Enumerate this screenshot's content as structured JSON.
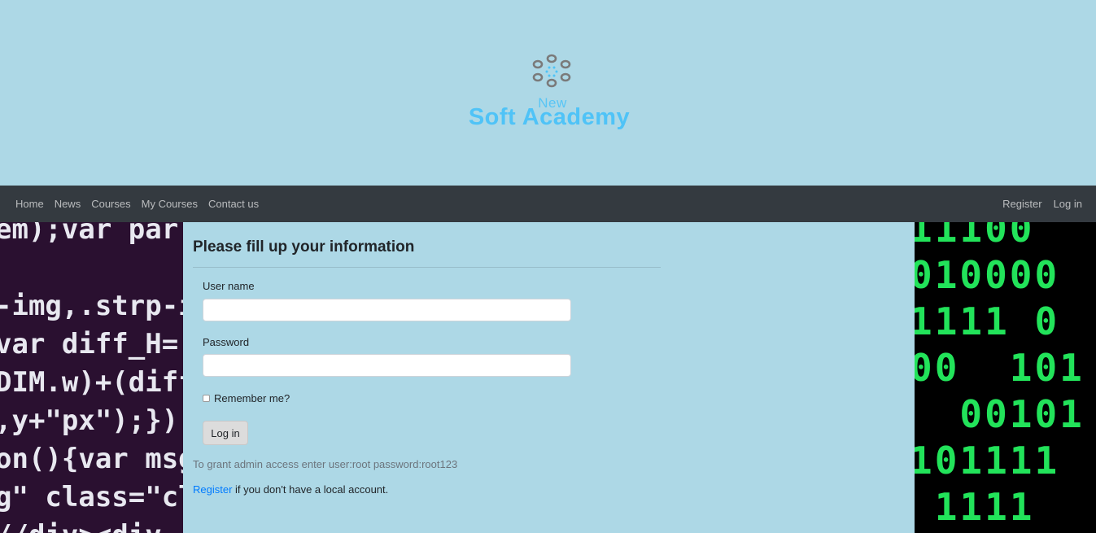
{
  "header": {
    "logo_small": "New",
    "logo_main": "Soft Academy"
  },
  "nav": {
    "left": [
      "Home",
      "News",
      "Courses",
      "My Courses",
      "Contact us"
    ],
    "right": [
      "Register",
      "Log in"
    ]
  },
  "background": {
    "left_code": "em);var par\n\n-img,.strp-i\nvar diff_H=\nDIM.w)+(diff\n,y+\"px\");});\non(){var msg\ng\" class=\"cl\n//div><div",
    "right_binary": "11100\n010000\n1111 0\n00  101\n  00101\n101111\n 1111"
  },
  "form": {
    "title": "Please fill up your information",
    "username_label": "User name",
    "username_value": "",
    "password_label": "Password",
    "password_value": "",
    "remember_label": "Remember me?",
    "remember_checked": false,
    "login_button": "Log in",
    "hint": "To grant admin access enter user:root password:root123",
    "register_link": "Register",
    "register_suffix": " if you don't have a local account."
  },
  "colors": {
    "page_background": "#add8e6",
    "navbar": "#343a40",
    "logo": "#4fc3f7",
    "link": "#007bff"
  }
}
